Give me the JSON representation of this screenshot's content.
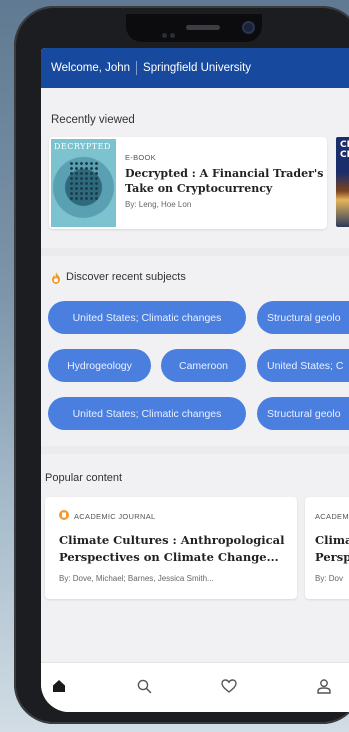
{
  "header": {
    "welcome": "Welcome, John",
    "institution": "Springfield University"
  },
  "recent": {
    "title": "Recently viewed",
    "items": [
      {
        "cover_text": "DECRYPTED",
        "kind": "E-BOOK",
        "title_line1": "Decrypted : A Financial Trader's",
        "title_line2": "Take on Cryptocurrency",
        "byline": "By: Leng, Hoe Lon"
      },
      {
        "cover_text_line1": "CLI",
        "cover_text_line2": "CHA"
      }
    ]
  },
  "subjects": {
    "title": "Discover recent subjects",
    "pills": [
      "United States; Climatic changes",
      "Structural geolo",
      "Hydrogeology",
      "Cameroon",
      "United States; C",
      "United States; Climatic changes",
      "Structural geolo"
    ]
  },
  "popular": {
    "title": "Popular content",
    "items": [
      {
        "kind": "ACADEMIC JOURNAL",
        "title_line1": "Climate Cultures : Anthropological",
        "title_line2": "Perspectives on Climate Change...",
        "byline": "By: Dove, Michael; Barnes, Jessica Smith..."
      },
      {
        "kind": "ACADEM",
        "title_line1": "Clima",
        "title_line2": "Persp",
        "byline": "By: Dov"
      }
    ]
  },
  "nav": {
    "items": [
      "home-icon",
      "search-icon",
      "heart-icon",
      "user-icon"
    ]
  },
  "colors": {
    "header": "#174a9e",
    "pill": "#4a7fe0",
    "accent": "#f29a2e"
  }
}
